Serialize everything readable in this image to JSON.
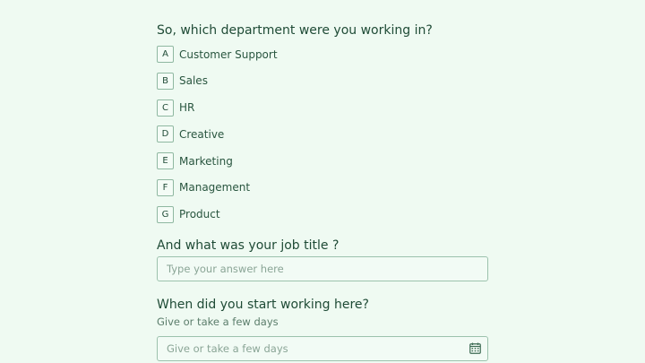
{
  "q1": {
    "title": "So, which department were you working in?",
    "options": [
      {
        "key": "A",
        "label": "Customer Support"
      },
      {
        "key": "B",
        "label": "Sales"
      },
      {
        "key": "C",
        "label": "HR"
      },
      {
        "key": "D",
        "label": "Creative"
      },
      {
        "key": "E",
        "label": "Marketing"
      },
      {
        "key": "F",
        "label": "Management"
      },
      {
        "key": "G",
        "label": "Product"
      }
    ]
  },
  "q2": {
    "title": "And what was your job title ?",
    "placeholder": "Type your answer here"
  },
  "q3": {
    "title": "When did you start working here?",
    "helper": "Give or take a few days",
    "placeholder": "Give or take a few days",
    "icon": "calendar-icon"
  },
  "colors": {
    "background": "#effaf2",
    "text": "#1f4b36",
    "border": "#9cc2ad"
  }
}
